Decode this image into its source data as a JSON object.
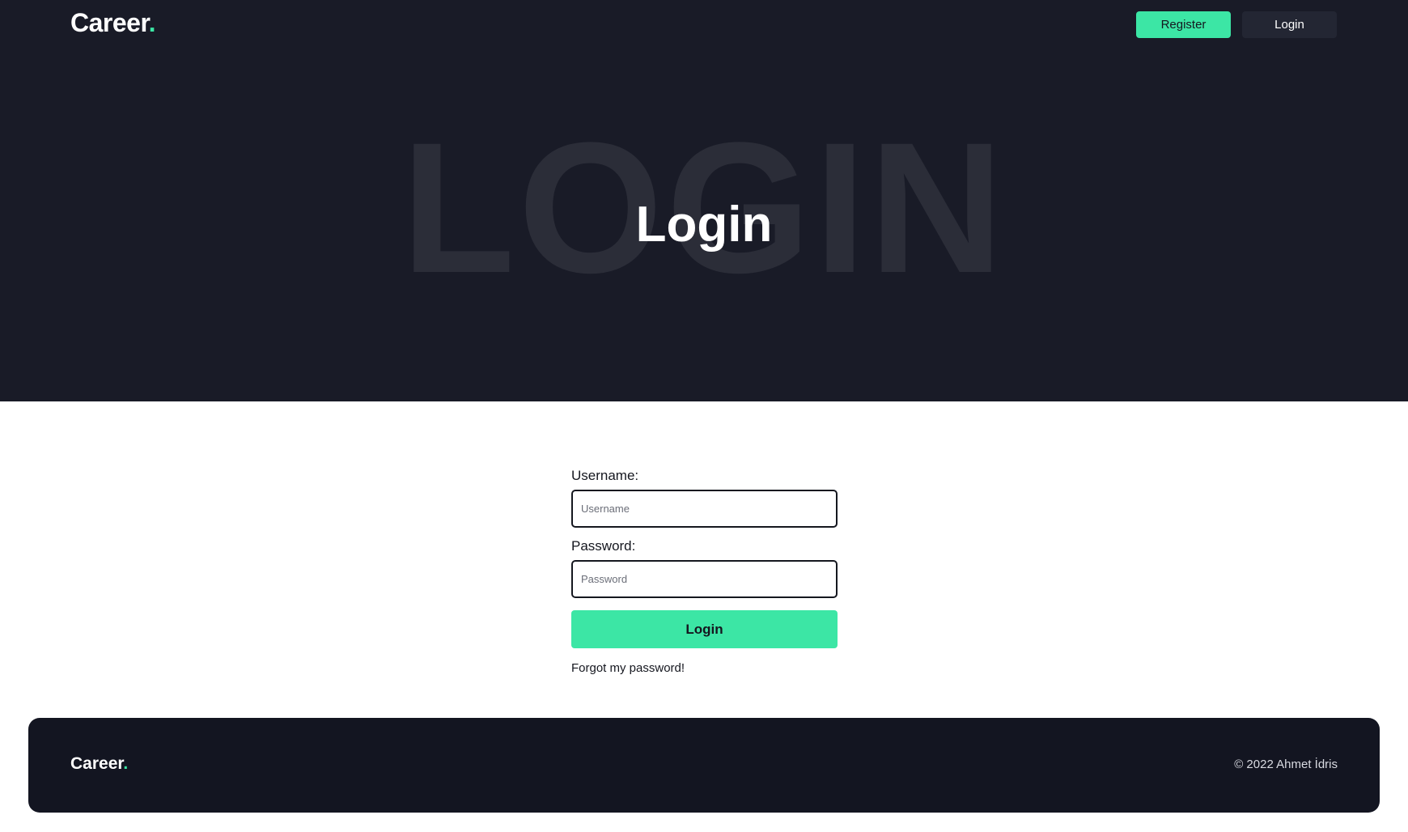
{
  "header": {
    "brand": "Career",
    "brand_dot": ".",
    "register_label": "Register",
    "login_label": "Login"
  },
  "hero": {
    "background_word": "LOGIN",
    "title": "Login"
  },
  "form": {
    "username_label": "Username:",
    "username_placeholder": "Username",
    "username_value": "",
    "password_label": "Password:",
    "password_placeholder": "Password",
    "password_value": "",
    "submit_label": "Login",
    "forgot_label": "Forgot my password!"
  },
  "footer": {
    "brand": "Career",
    "brand_dot": ".",
    "copyright": "© 2022 Ahmet İdris"
  },
  "colors": {
    "accent": "#3ce6a5",
    "hero_bg": "#191b27",
    "footer_bg": "#131521"
  }
}
